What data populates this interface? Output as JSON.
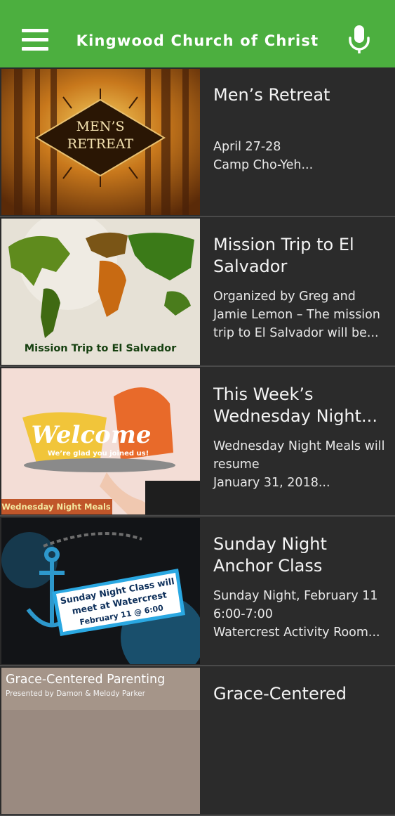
{
  "header": {
    "title": "Kingwood Church of Christ",
    "menu_icon": "hamburger-menu-icon",
    "mic_icon": "microphone-icon",
    "accent_color": "#4caf3f"
  },
  "events": [
    {
      "title": "Men’s Retreat",
      "desc": [
        "April 27-28",
        "Camp Cho-Yeh..."
      ],
      "image_text": [
        "MEN’S",
        "RETREAT"
      ]
    },
    {
      "title": "Mission Trip to El Salvador",
      "desc": [
        "Organized by Greg and Jamie Lemon – The mission trip to El Salvador will be..."
      ],
      "image_text": [
        "Mission Trip to El Salvador"
      ]
    },
    {
      "title": "This Week’s Wednesday Night...",
      "desc": [
        "Wednesday Night Meals will resume",
        "January 31, 2018..."
      ],
      "image_text": [
        "Welcome",
        "We’re glad you joined us!",
        "Wednesday Night Meals"
      ]
    },
    {
      "title": "Sunday Night Anchor Class",
      "desc": [
        "Sunday Night, February 11",
        "6:00-7:00",
        "Watercrest Activity Room..."
      ],
      "image_text": [
        "Sunday Night Class will",
        "meet at Watercrest",
        "February 11 @ 6:00"
      ]
    },
    {
      "title": "Grace-Centered",
      "desc": [],
      "image_text": [
        "Grace-Centered Parenting",
        "Presented by Damon & Melody Parker"
      ]
    }
  ]
}
